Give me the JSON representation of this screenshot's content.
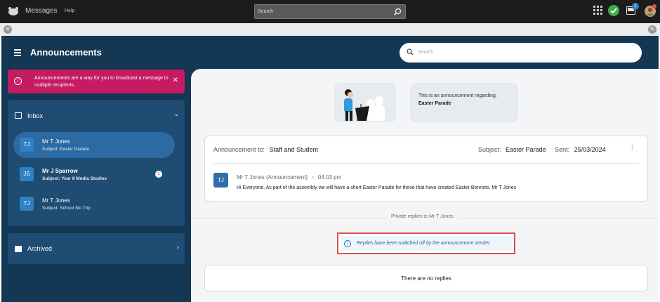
{
  "topbar": {
    "app_title": "Messages",
    "help_label": "Help",
    "search_placeholder": "Search",
    "notification_count": "1",
    "icons": [
      "grid-icon",
      "check-icon",
      "inbox-tray-icon",
      "user-avatar"
    ]
  },
  "header": {
    "title": "Announcements",
    "search_placeholder": "Search..."
  },
  "alert": {
    "text": "Announcements are a way for you to broadcast a message to multiple recipients.",
    "close": "✕"
  },
  "sidebar": {
    "inbox_label": "Inbox",
    "archived_label": "Archived",
    "messages": [
      {
        "initials": "TJ",
        "name": "Mr T Jones",
        "subject": "Subject: Easter Parade",
        "unread": ""
      },
      {
        "initials": "JS",
        "name": "Mr J Sparrow",
        "subject": "Subject: Year 8 Media Studies",
        "unread": "1"
      },
      {
        "initials": "TJ",
        "name": "Mr T Jones",
        "subject": "Subject: School Ski Trip",
        "unread": ""
      }
    ]
  },
  "main": {
    "regarding_line1": "This is an announcement regarding:",
    "regarding_line2": "Easter Parade",
    "announcement_to_label": "Announcement to:",
    "announcement_to_value": "Staff and Student",
    "subject_label": "Subject:",
    "subject_value": "Easter Parade",
    "sent_label": "Sent:",
    "sent_value": "25/03/2024",
    "sender_initials": "TJ",
    "sender_name": "Mr T Jones (Announcement)",
    "sender_time": "04:03 pm",
    "body": "Hi Everyone, As part of the assembly we will have a short Easter Parade for those that have created Easter Bonnets. Mr T Jones",
    "replies_label": "Private replies to Mr T Jones",
    "replies_off_notice": "Replies have been switched off by the announcement sender",
    "no_replies": "There are no replies"
  },
  "colors": {
    "topbar": "#1c1c1c",
    "sidebar_bg": "#143753",
    "panel_bg": "#1f4c73",
    "active_item": "#2b6aa3",
    "alert_bg": "#c51b63",
    "main_bg": "#f4f5f7",
    "highlight_border": "#d9534f"
  }
}
